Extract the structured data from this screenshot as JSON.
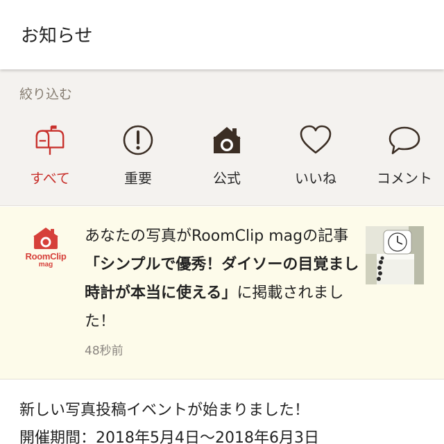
{
  "header": {
    "title": "お知らせ"
  },
  "filter": {
    "heading": "絞り込む",
    "active_color": "#c8312c",
    "items": [
      {
        "label": "すべて",
        "icon": "mailbox-icon",
        "active": true
      },
      {
        "label": "重要",
        "icon": "exclamation-circle-icon",
        "active": false
      },
      {
        "label": "公式",
        "icon": "house-camera-icon",
        "active": false
      },
      {
        "label": "いいね",
        "icon": "heart-icon",
        "active": false
      },
      {
        "label": "コメント",
        "icon": "speech-bubble-icon",
        "active": false
      }
    ]
  },
  "notifications": [
    {
      "logo_line1": "RoomClip",
      "logo_line2": "mag",
      "text_prefix": "あなたの写真がRoomClip magの記事",
      "text_bold": "「シンプルで優秀！ダイソーの目覚まし時計が本当に使える」",
      "text_suffix": "に掲載されました！",
      "time": "48秒前",
      "thumbnail_icon": "clock-photo-thumbnail"
    }
  ],
  "event": {
    "line1": "新しい写真投稿イベントが始まりました！",
    "line2": "開催期間：2018年5月4日〜2018年6月3日"
  },
  "colors": {
    "brand_red": "#d6403a",
    "filter_bg": "#f4f2ef",
    "highlight_bg": "#fdfbea",
    "icon_dark": "#3b2e24"
  }
}
